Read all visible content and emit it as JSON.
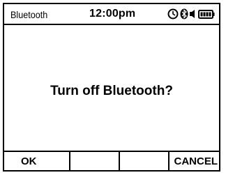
{
  "status_bar": {
    "title": "Bluetooth",
    "time": "12:00pm",
    "icons": [
      "clock-icon",
      "bluetooth-icon",
      "speaker-icon",
      "battery-icon"
    ]
  },
  "dialog": {
    "message": "Turn off Bluetooth?"
  },
  "softkeys": [
    {
      "label": "OK"
    },
    {
      "label": ""
    },
    {
      "label": ""
    },
    {
      "label": "CANCEL"
    }
  ],
  "colors": {
    "foreground": "#000000",
    "background": "#ffffff"
  }
}
